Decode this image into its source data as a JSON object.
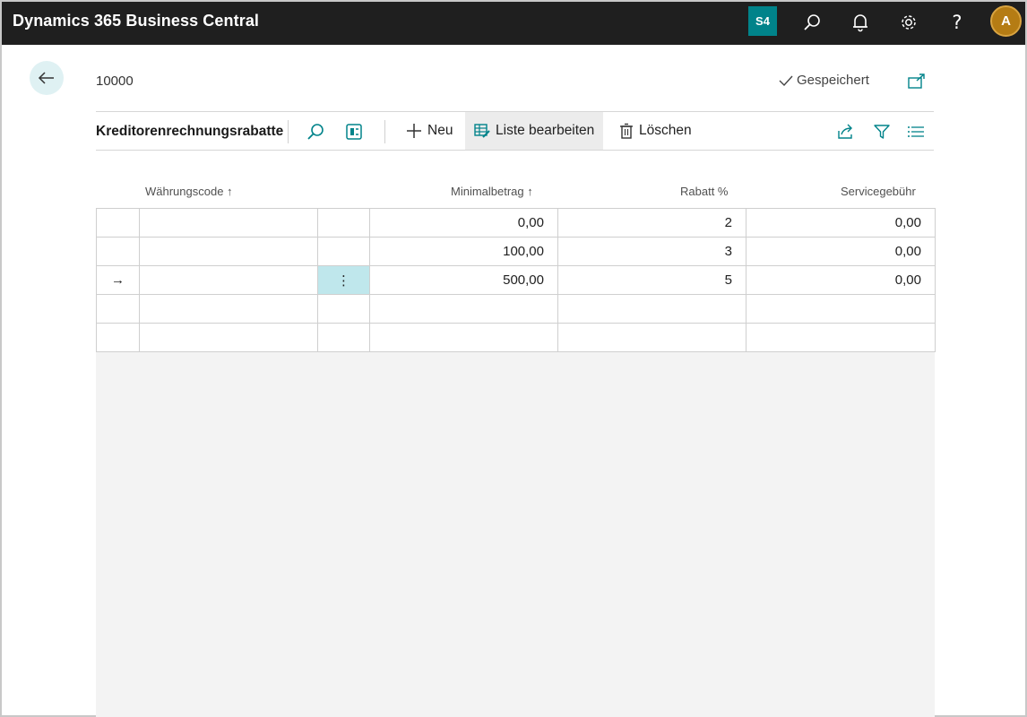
{
  "app": {
    "title": "Dynamics 365 Business Central",
    "company_badge": "S4",
    "user_initial": "A"
  },
  "topbar_icons": [
    "search-icon",
    "bell-icon",
    "gear-icon",
    "help-icon"
  ],
  "header": {
    "record_no": "10000",
    "saved_label": "Gespeichert"
  },
  "action_bar": {
    "caption": "Kreditorenrechnungsrabatte",
    "new_label": "Neu",
    "edit_list_label": "Liste bearbeiten",
    "delete_label": "Löschen"
  },
  "columns": {
    "currency": "Währungscode ↑",
    "min_amount": "Minimalbetrag ↑",
    "discount": "Rabatt %",
    "service_fee": "Servicegebühr"
  },
  "rows": [
    {
      "indicator": "",
      "currency": "",
      "menu": "",
      "min_amount": "0,00",
      "discount": "2",
      "service_fee": "0,00"
    },
    {
      "indicator": "",
      "currency": "",
      "menu": "",
      "min_amount": "100,00",
      "discount": "3",
      "service_fee": "0,00"
    },
    {
      "indicator": "→",
      "currency": "",
      "menu": "⋮",
      "min_amount": "500,00",
      "discount": "5",
      "service_fee": "0,00"
    },
    {
      "indicator": "",
      "currency": "",
      "menu": "",
      "min_amount": "",
      "discount": "",
      "service_fee": ""
    },
    {
      "indicator": "",
      "currency": "",
      "menu": "",
      "min_amount": "",
      "discount": "",
      "service_fee": ""
    }
  ],
  "colors": {
    "topbar": "#1f1f1f",
    "accent": "#00838a",
    "avatar": "#b57c14",
    "selected_cell": "#bfe7ec"
  }
}
